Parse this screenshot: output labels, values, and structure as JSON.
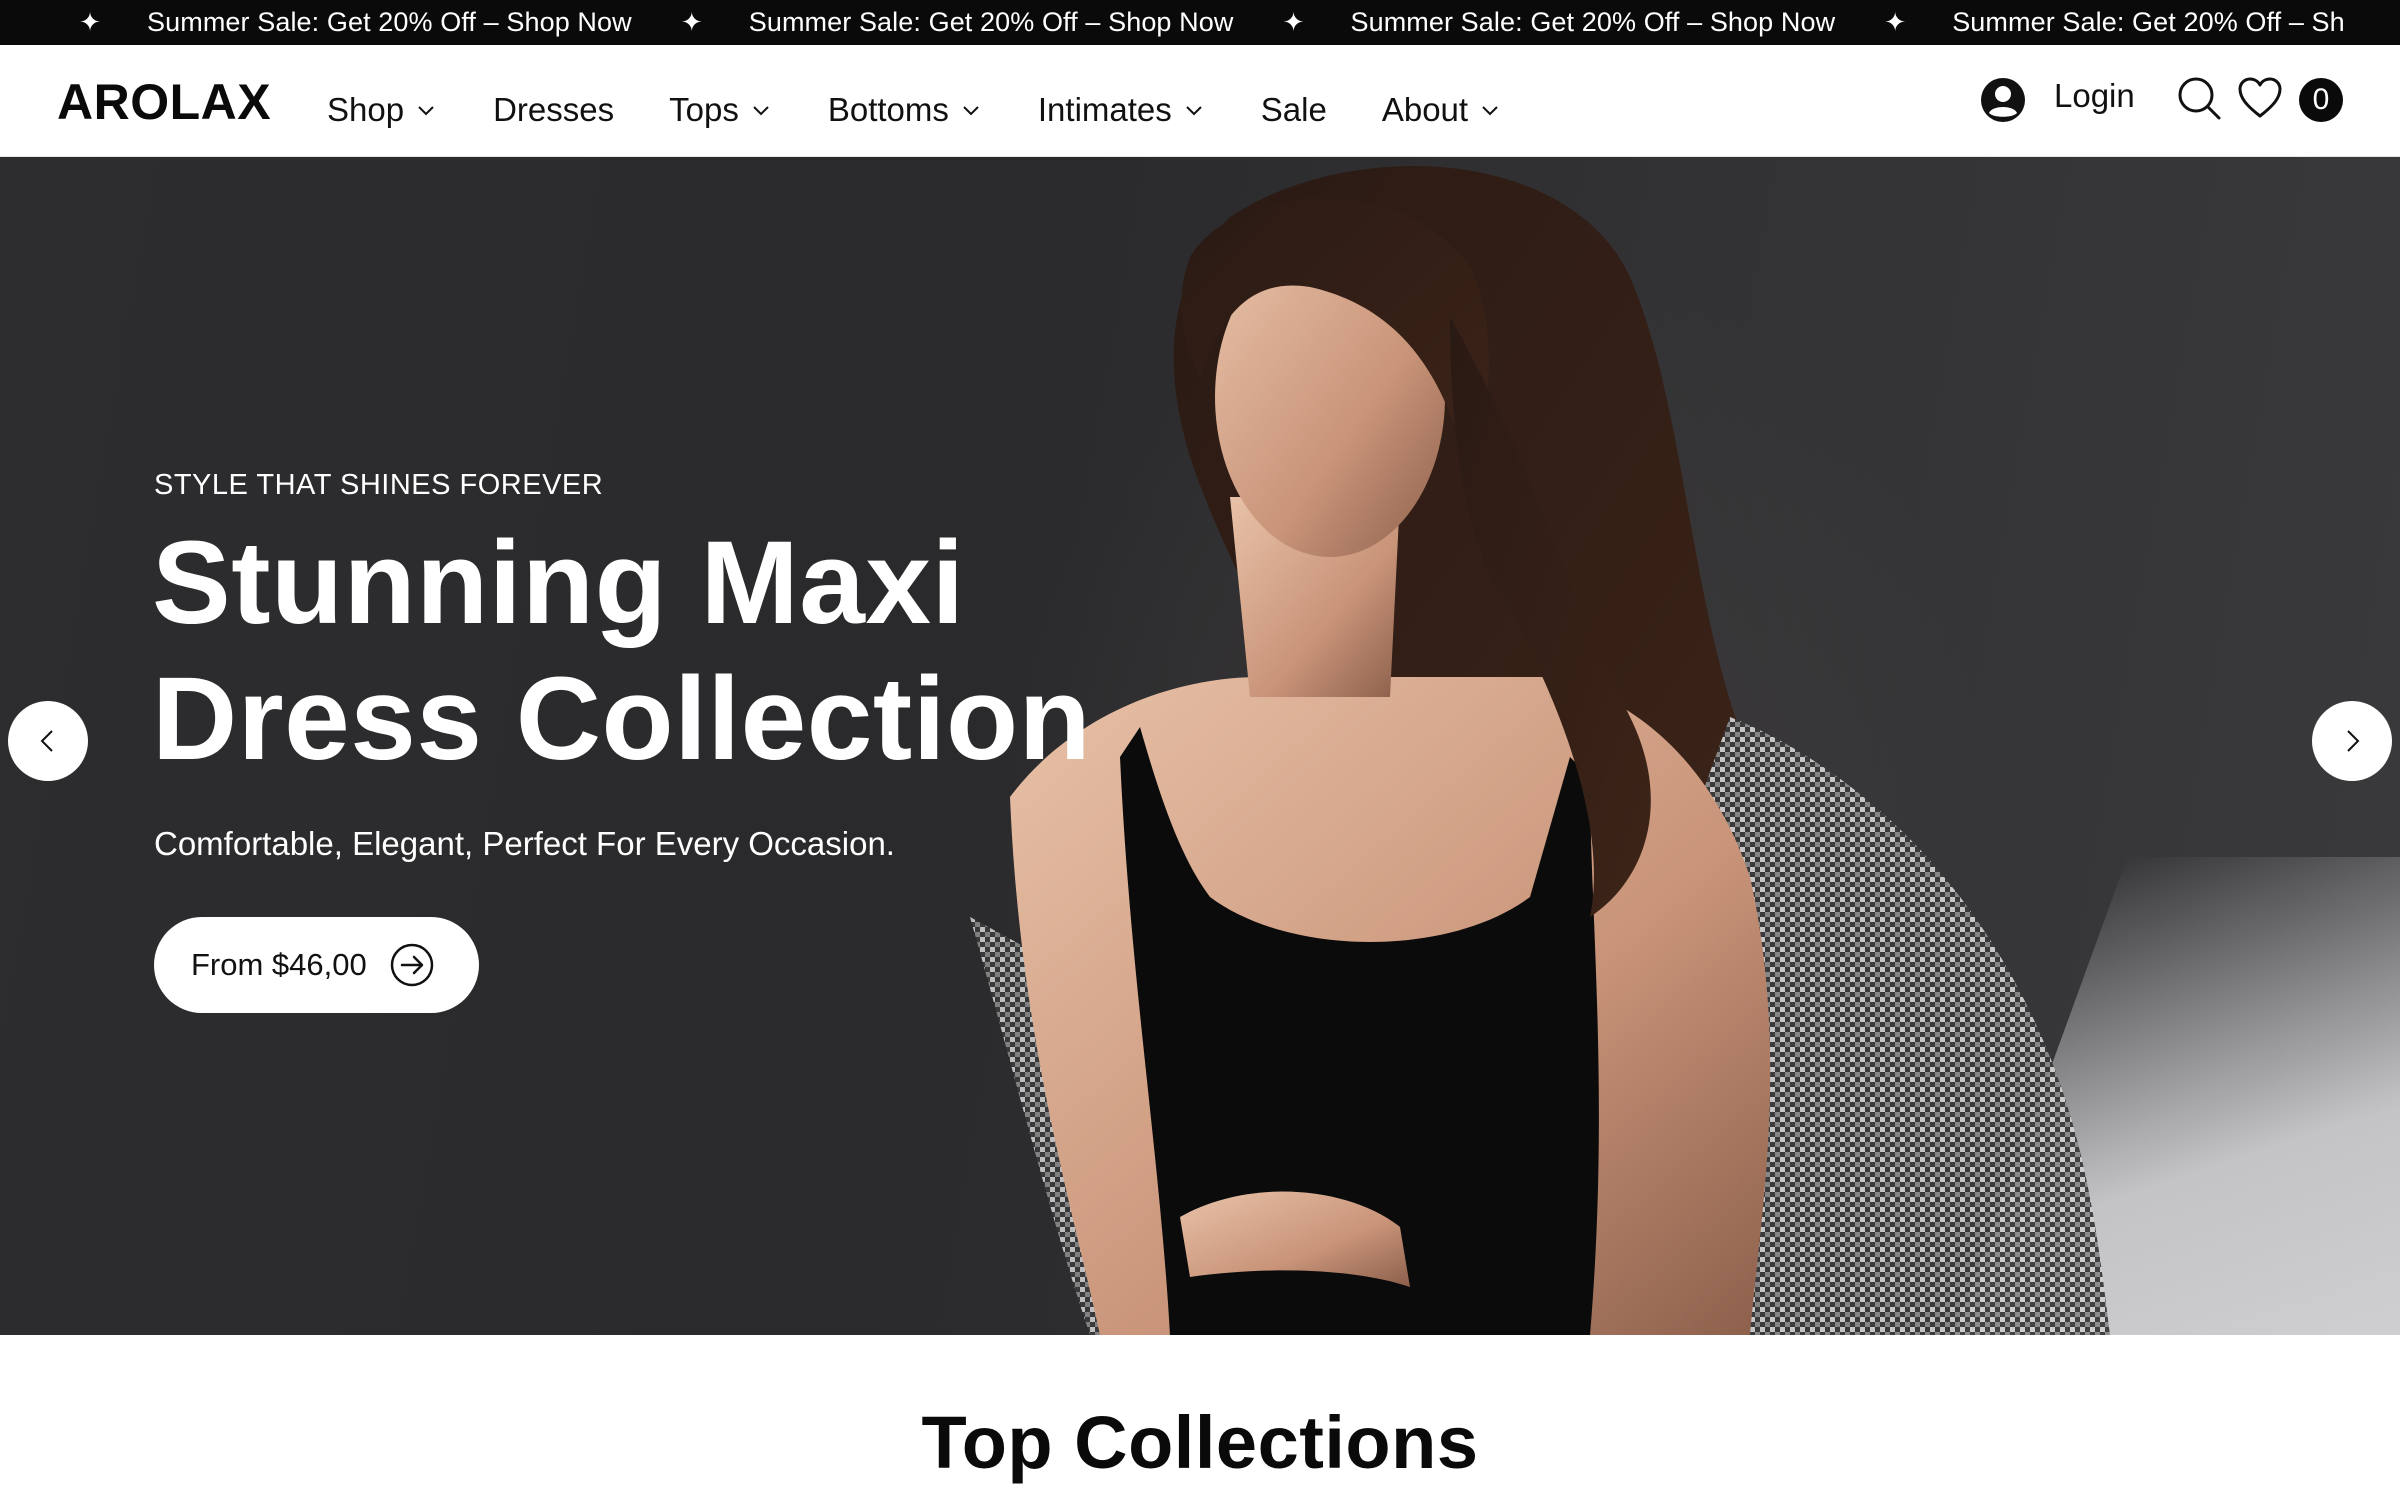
{
  "announcement": {
    "items": [
      "Summer Sale: Get 20% Off – Shop Now",
      "Summer Sale: Get 20% Off – Shop Now",
      "Summer Sale: Get 20% Off – Shop Now",
      "Summer Sale: Get 20% Off – Sh"
    ],
    "separator_icon": "sparkle-icon"
  },
  "header": {
    "logo": "AROLAX",
    "nav": [
      {
        "label": "Shop",
        "has_dropdown": true
      },
      {
        "label": "Dresses",
        "has_dropdown": false
      },
      {
        "label": "Tops",
        "has_dropdown": true
      },
      {
        "label": "Bottoms",
        "has_dropdown": true
      },
      {
        "label": "Intimates",
        "has_dropdown": true
      },
      {
        "label": "Sale",
        "has_dropdown": false
      },
      {
        "label": "About",
        "has_dropdown": true
      }
    ],
    "login_label": "Login",
    "cart_count": "0",
    "icons": [
      "user-icon",
      "search-icon",
      "heart-icon",
      "cart-badge"
    ]
  },
  "hero": {
    "eyebrow": "STYLE THAT SHINES FOREVER",
    "title_line1": "Stunning Maxi",
    "title_line2": "Dress Collection",
    "subtitle": "Comfortable, Elegant, Perfect For Every Occasion.",
    "cta_label": "From $46,00",
    "image_alt": "Model in black slip dress with houndstooth jacket"
  },
  "sections": {
    "top_collections_title": "Top Collections"
  },
  "colors": {
    "announce_bg": "#0a0a0a",
    "hero_bg": "#2d2d2f",
    "text_dark": "#111111",
    "white": "#ffffff"
  }
}
